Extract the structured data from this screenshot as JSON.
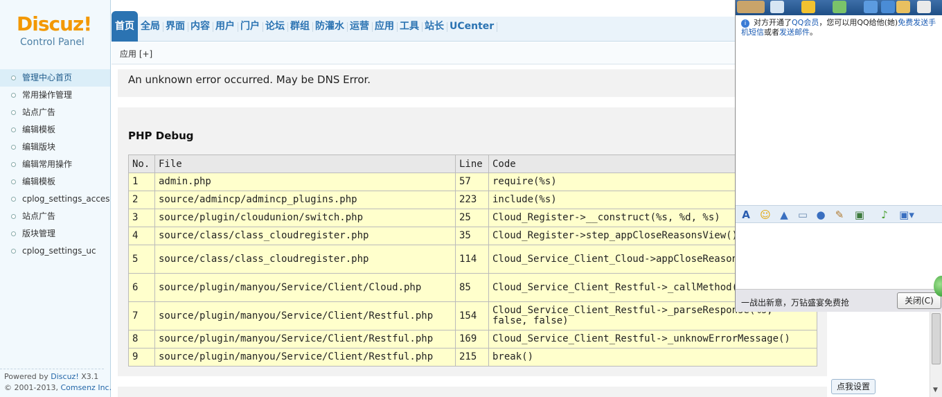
{
  "logo": {
    "brand": "Discuz!",
    "subtitle": "Control Panel"
  },
  "topnav": {
    "tabs": [
      "首页",
      "全局",
      "界面",
      "内容",
      "用户",
      "门户",
      "论坛",
      "群组",
      "防灌水",
      "运营",
      "应用",
      "工具",
      "站长",
      "UCenter"
    ],
    "active": 0
  },
  "subnav": {
    "label": "应用 [+]"
  },
  "sidebar": {
    "items": [
      "管理中心首页",
      "常用操作管理",
      "站点广告",
      "编辑模板",
      "编辑版块",
      "编辑常用操作",
      "编辑模板",
      "cplog_settings_access",
      "站点广告",
      "版块管理",
      "cplog_settings_uc"
    ],
    "active": 0
  },
  "footer": {
    "powered_prefix": "Powered by ",
    "powered_link": "Discuz!",
    "version": " X3.1",
    "copy_prefix": "© 2001-2013, ",
    "copy_link": "Comsenz Inc."
  },
  "error": {
    "message": "An unknown error occurred. May be DNS Error."
  },
  "debug": {
    "title": "PHP Debug",
    "headers": [
      "No.",
      "File",
      "Line",
      "Code"
    ],
    "rows": [
      [
        "1",
        "admin.php",
        "57",
        "require(%s)"
      ],
      [
        "2",
        "source/admincp/admincp_plugins.php",
        "223",
        "include(%s)"
      ],
      [
        "3",
        "source/plugin/cloudunion/switch.php",
        "25",
        "Cloud_Register->__construct(%s, %d, %s)"
      ],
      [
        "4",
        "source/class/class_cloudregister.php",
        "35",
        "Cloud_Register->step_appCloseReasonsView()"
      ],
      [
        "5",
        "source/class/class_cloudregister.php",
        "114",
        "Cloud_Service_Client_Cloud->appCloseReasons(%s, %s)"
      ],
      [
        "6",
        "source/plugin/manyou/Service/Client/Cloud.php",
        "85",
        "Cloud_Service_Client_Restful->_callMethod(%s, Array)"
      ],
      [
        "7",
        "source/plugin/manyou/Service/Client/Restful.php",
        "154",
        "Cloud_Service_Client_Restful->_parseResponse(%s, false, false)"
      ],
      [
        "8",
        "source/plugin/manyou/Service/Client/Restful.php",
        "169",
        "Cloud_Service_Client_Restful->_unknowErrorMessage()"
      ],
      [
        "9",
        "source/plugin/manyou/Service/Client/Restful.php",
        "215",
        "break()"
      ]
    ]
  },
  "qq": {
    "info_text": "对方开通了",
    "info_link1": "QQ会员",
    "info_mid": "，您可以用QQ给他(她)",
    "info_link2": "免费发送手机短信",
    "info_or": "或者",
    "info_link3": "发送邮件",
    "info_end": "。",
    "ad_text": "一战出新意，万钻盛宴免费抢",
    "close_label": "关闭(C)"
  },
  "tip_button": "点我设置"
}
